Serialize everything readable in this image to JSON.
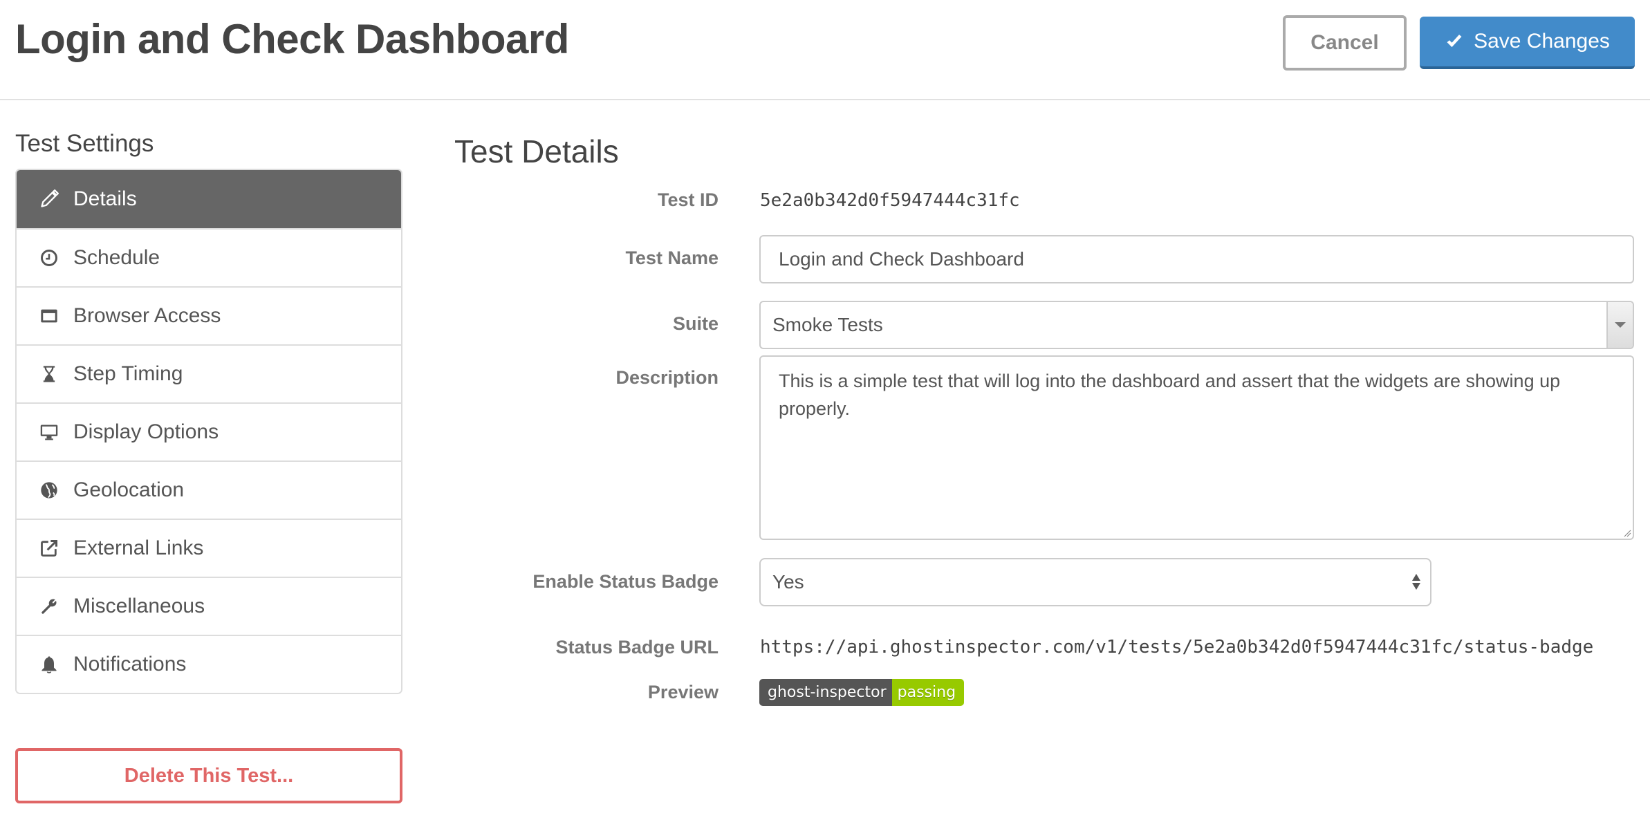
{
  "header": {
    "title": "Login and Check Dashboard",
    "cancel_label": "Cancel",
    "save_label": "Save Changes",
    "save_icon": "check-icon"
  },
  "sidebar": {
    "title": "Test Settings",
    "items": [
      {
        "label": "Details",
        "icon": "pencil-icon",
        "active": true
      },
      {
        "label": "Schedule",
        "icon": "clock-icon",
        "active": false
      },
      {
        "label": "Browser Access",
        "icon": "browser-window-icon",
        "active": false
      },
      {
        "label": "Step Timing",
        "icon": "hourglass-icon",
        "active": false
      },
      {
        "label": "Display Options",
        "icon": "desktop-icon",
        "active": false
      },
      {
        "label": "Geolocation",
        "icon": "globe-icon",
        "active": false
      },
      {
        "label": "External Links",
        "icon": "external-link-icon",
        "active": false
      },
      {
        "label": "Miscellaneous",
        "icon": "wrench-icon",
        "active": false
      },
      {
        "label": "Notifications",
        "icon": "bell-icon",
        "active": false
      }
    ],
    "delete_label": "Delete This Test..."
  },
  "main": {
    "section_title": "Test Details",
    "fields": {
      "test_id": {
        "label": "Test ID",
        "value": "5e2a0b342d0f5947444c31fc"
      },
      "test_name": {
        "label": "Test Name",
        "value": "Login and Check Dashboard"
      },
      "suite": {
        "label": "Suite",
        "value": "Smoke Tests"
      },
      "description": {
        "label": "Description",
        "value": "This is a simple test that will log into the dashboard and assert that the widgets are showing up properly."
      },
      "enable_status_badge": {
        "label": "Enable Status Badge",
        "value": "Yes"
      },
      "status_badge_url": {
        "label": "Status Badge URL",
        "value": "https://api.ghostinspector.com/v1/tests/5e2a0b342d0f5947444c31fc/status-badge"
      },
      "preview": {
        "label": "Preview",
        "badge_left": "ghost-inspector",
        "badge_right": "passing"
      }
    }
  },
  "colors": {
    "primary": "#428bca",
    "danger": "#e06666",
    "sidebar_active": "#666666",
    "badge_dark": "#555555",
    "badge_passing": "#97ca00"
  }
}
